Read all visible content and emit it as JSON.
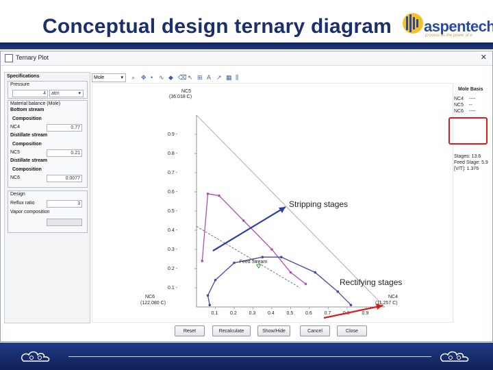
{
  "slide": {
    "title": "Conceptual design ternary diagram",
    "logo": {
      "name": "aspentech",
      "tagline": "process  as the power of e"
    }
  },
  "window": {
    "title": "Ternary Plot",
    "close_label": "✕"
  },
  "left_panel": {
    "specifications_label": "Specifications",
    "pressure_label": "Pressure",
    "pressure_value": "4",
    "pressure_unit": "atm",
    "material_balance_label": "Material balance (Mole)",
    "bottom_stream_label": "Bottom stream",
    "bottom_composition_label": "Composition",
    "bottom_comp": {
      "name": "NC4",
      "value": "0.77"
    },
    "distillate_stream_label": "Distillate stream",
    "distillate_composition_label": "Composition",
    "distillate_comp": {
      "name": "NC5",
      "value": "0.21"
    },
    "distillate2_stream_label": "Distillate stream",
    "distillate2_composition_label": "Composition",
    "distillate2_comp": {
      "name": "NC6",
      "value": "0.0077"
    },
    "design_label": "Design",
    "reflux_ratio_label": "Reflux ratio",
    "reflux_ratio_value": "3",
    "vapor_composition_label": "Vapor composition"
  },
  "toolbar": {
    "basis": "Mole",
    "icons": [
      "zoom-icon",
      "pan-icon",
      "point-icon",
      "curve-icon",
      "marker-icon",
      "eraser-icon",
      "select-icon",
      "grid-icon",
      "label-icon",
      "arrow-icon",
      "table-icon",
      "columns-icon"
    ]
  },
  "right_info": {
    "basis_title": "Mole Basis",
    "rows": [
      {
        "name": "NC4",
        "value": "----"
      },
      {
        "name": "NC5",
        "value": "--"
      },
      {
        "name": "NC6",
        "value": "----"
      }
    ],
    "stages_label": "Stages: 13.6",
    "feed_stage_label": "Feed Stage: 5.9",
    "vt_label": "[V/T]: 1.376"
  },
  "buttons": {
    "reset": "Reset",
    "recalculate": "Recalculate",
    "show_hide": "Show/Hide",
    "cancel": "Cancel",
    "close": "Close"
  },
  "chart_data": {
    "type": "scatter",
    "top_vertex": {
      "name": "NC5",
      "temp": "(36.018 C)"
    },
    "left_vertex": {
      "name": "NC6",
      "temp": "(122.080 C)"
    },
    "right_vertex": {
      "name": "NC4",
      "temp": "(11.257 C)"
    },
    "axis_ticks": [
      "0.9",
      "0.8",
      "0.7",
      "0.6",
      "0.5",
      "0.4",
      "0.3",
      "0.2",
      "0.1"
    ],
    "bottom_ticks": [
      "0.1",
      "0.2",
      "0.3",
      "0.4",
      "0.5",
      "0.6",
      "0.7",
      "0.8",
      "0.9"
    ],
    "feed_label": "Feed Stream",
    "annotations": {
      "stripping": "Stripping stages",
      "rectifying": "Rectifying stages"
    },
    "stripping_profile": {
      "name": "Stripping",
      "color": "#b04ab8",
      "points": [
        [
          0.03,
          0.24
        ],
        [
          0.06,
          0.59
        ],
        [
          0.12,
          0.58
        ],
        [
          0.25,
          0.45
        ],
        [
          0.4,
          0.3
        ],
        [
          0.5,
          0.18
        ],
        [
          0.58,
          0.12
        ]
      ]
    },
    "rectifying_profile": {
      "name": "Rectifying",
      "color": "#3f4aa0",
      "points": [
        [
          0.82,
          0.01
        ],
        [
          0.75,
          0.08
        ],
        [
          0.63,
          0.18
        ],
        [
          0.45,
          0.26
        ],
        [
          0.35,
          0.26
        ],
        [
          0.2,
          0.23
        ],
        [
          0.1,
          0.14
        ],
        [
          0.06,
          0.06
        ],
        [
          0.07,
          0.01
        ]
      ]
    },
    "feed_point": [
      0.33,
      0.21
    ],
    "balance_line": [
      [
        0.0,
        0.42
      ],
      [
        0.55,
        0.1
      ]
    ],
    "diagonal": [
      [
        0.0,
        1.0
      ],
      [
        1.0,
        0.0
      ]
    ]
  }
}
